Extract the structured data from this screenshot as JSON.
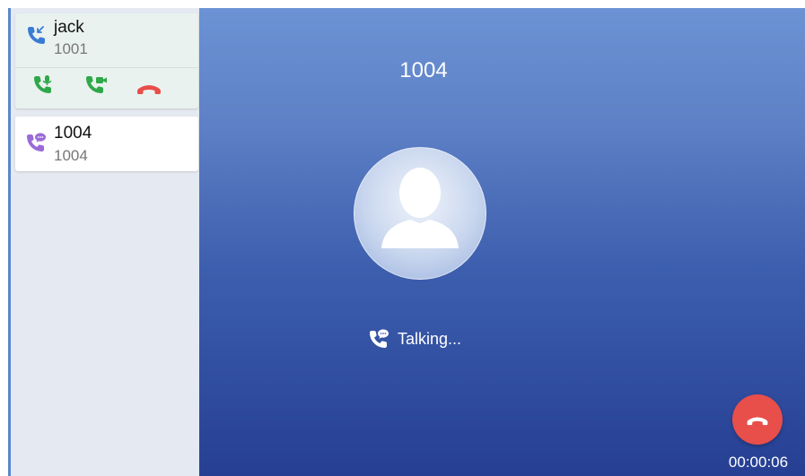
{
  "calls": [
    {
      "name": "jack",
      "number": "1001",
      "state": "incoming"
    },
    {
      "name": "1004",
      "number": "1004",
      "state": "active"
    }
  ],
  "active_call": {
    "number": "1004",
    "status": "Talking...",
    "duration": "00:00:06"
  },
  "icons": {
    "incoming": "incoming-call-icon",
    "talking": "talking-phone-icon",
    "answer_audio": "answer-audio-icon",
    "answer_video": "answer-video-icon",
    "reject": "reject-call-icon",
    "avatar": "person-avatar-icon",
    "hangup": "hang-up-icon"
  },
  "colors": {
    "answer_green": "#2fa84a",
    "reject_red": "#e84e4a",
    "incoming_blue": "#3a7bd5",
    "talking_purple": "#9a6bd8",
    "background_blue": "#4a6cb8"
  }
}
